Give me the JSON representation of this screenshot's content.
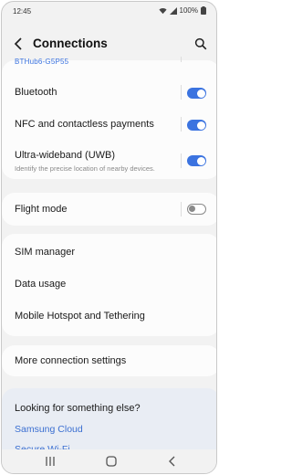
{
  "status": {
    "time": "12:45",
    "battery": "100%"
  },
  "appbar": {
    "title": "Connections"
  },
  "cut_item": {
    "label": "BTHub6-G5P55"
  },
  "settings_card1": [
    {
      "label": "Bluetooth",
      "on": true
    },
    {
      "label": "NFC and contactless payments",
      "on": true
    },
    {
      "label": "Ultra-wideband (UWB)",
      "sub": "Identify the precise location of nearby devices.",
      "on": true
    }
  ],
  "settings_card2": [
    {
      "label": "Flight mode",
      "on": false
    }
  ],
  "settings_card3": [
    {
      "label": "SIM manager"
    },
    {
      "label": "Data usage"
    },
    {
      "label": "Mobile Hotspot and Tethering"
    }
  ],
  "settings_card4": [
    {
      "label": "More connection settings"
    }
  ],
  "looking": {
    "heading": "Looking for something else?",
    "links": [
      "Samsung Cloud",
      "Secure Wi-Fi"
    ]
  },
  "colors": {
    "accent": "#3b73e0",
    "background": "#f2f2f2",
    "card": "#fcfcfc",
    "looking_bg": "#e9edf4"
  },
  "icons": [
    "wifi-icon",
    "signal-icon",
    "battery-icon",
    "back-arrow-icon",
    "search-icon",
    "recents-icon",
    "home-icon",
    "nav-back-icon"
  ]
}
